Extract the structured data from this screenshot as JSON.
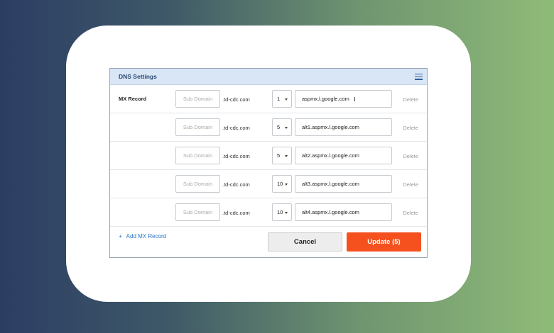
{
  "panel": {
    "title": "DNS Settings",
    "menu_icon": "hamburger-menu-icon"
  },
  "mx_label": "MX Record",
  "records": [
    {
      "subdomain_placeholder": "Sub Domain",
      "domain_suffix": ".td-cdc.com",
      "priority": "1",
      "server": "aspmx.l.google.com",
      "delete_label": "Delete"
    },
    {
      "subdomain_placeholder": "Sub Domain",
      "domain_suffix": ".td-cdc.com",
      "priority": "5",
      "server": "alt1.aspmx.l.google.com",
      "delete_label": "Delete"
    },
    {
      "subdomain_placeholder": "Sub Domain",
      "domain_suffix": ".td-cdc.com",
      "priority": "5",
      "server": "alt2.aspmx.l.google.com",
      "delete_label": "Delete"
    },
    {
      "subdomain_placeholder": "Sub Domain",
      "domain_suffix": ".td-cdc.com",
      "priority": "10",
      "server": "alt3.aspmx.l.google.com",
      "delete_label": "Delete"
    },
    {
      "subdomain_placeholder": "Sub Domain",
      "domain_suffix": ".td-cdc.com",
      "priority": "10",
      "server": "alt4.aspmx.l.google.com",
      "delete_label": "Delete"
    }
  ],
  "footer": {
    "add_plus": "+",
    "add_label": "Add MX Record",
    "cancel_label": "Cancel",
    "update_label": "Update (5)"
  },
  "colors": {
    "accent": "#f4511e",
    "header_bg": "#d9e6f5",
    "link": "#2a76c6"
  }
}
